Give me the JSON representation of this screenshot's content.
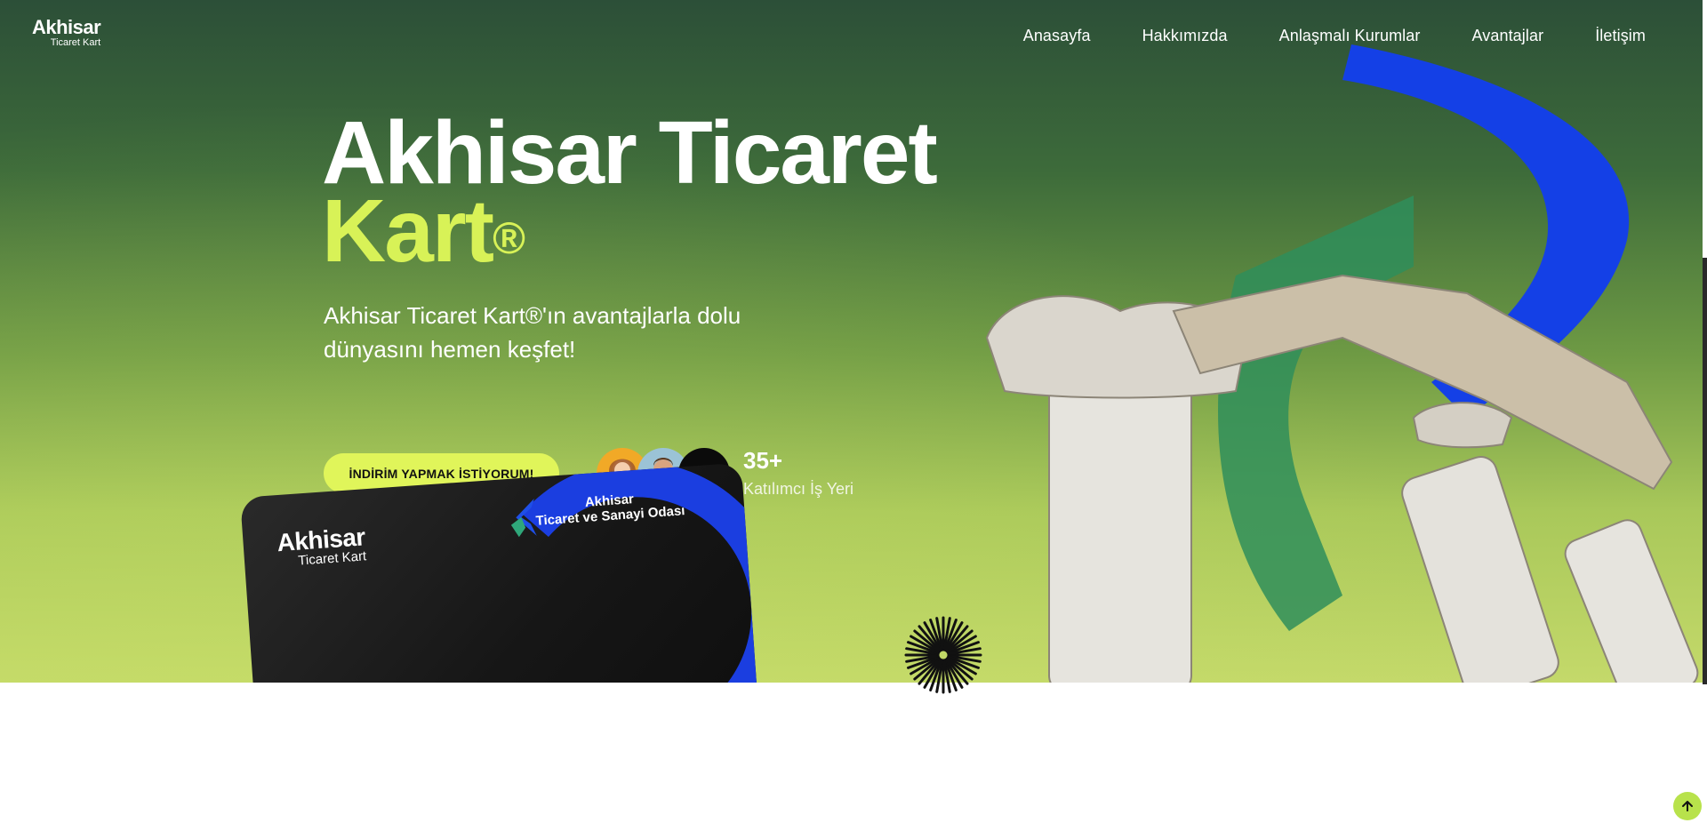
{
  "brand": {
    "logo_line1": "Akhisar",
    "logo_line2": "Ticaret Kart"
  },
  "nav": {
    "items": [
      "Anasayfa",
      "Hakkımızda",
      "Anlaşmalı Kurumlar",
      "Avantajlar",
      "İletişim"
    ]
  },
  "hero": {
    "title_line1": "Akhisar Ticaret",
    "title_line2": "Kart",
    "title_mark": "®",
    "subtitle": "Akhisar Ticaret Kart®'ın avantajlarla dolu dünyasını hemen keşfet!",
    "cta_label": "İNDİRİM YAPMAK İSTİYORUM!",
    "stat_number": "35+",
    "stat_label": "Katılımcı İş Yeri",
    "avatar_more": "+"
  },
  "card": {
    "brand_line1": "Akhisar",
    "brand_line2": "Ticaret Kart",
    "chamber_line1": "Akhisar",
    "chamber_line2": "Ticaret ve Sanayi Odası"
  },
  "colors": {
    "accent": "#d8f257",
    "cta": "#e0f55a",
    "blue": "#1b3ee0",
    "scroll_top": "#b8e24b"
  },
  "icons": {
    "scroll_top": "arrow-up-icon",
    "burst": "sunburst-icon"
  }
}
